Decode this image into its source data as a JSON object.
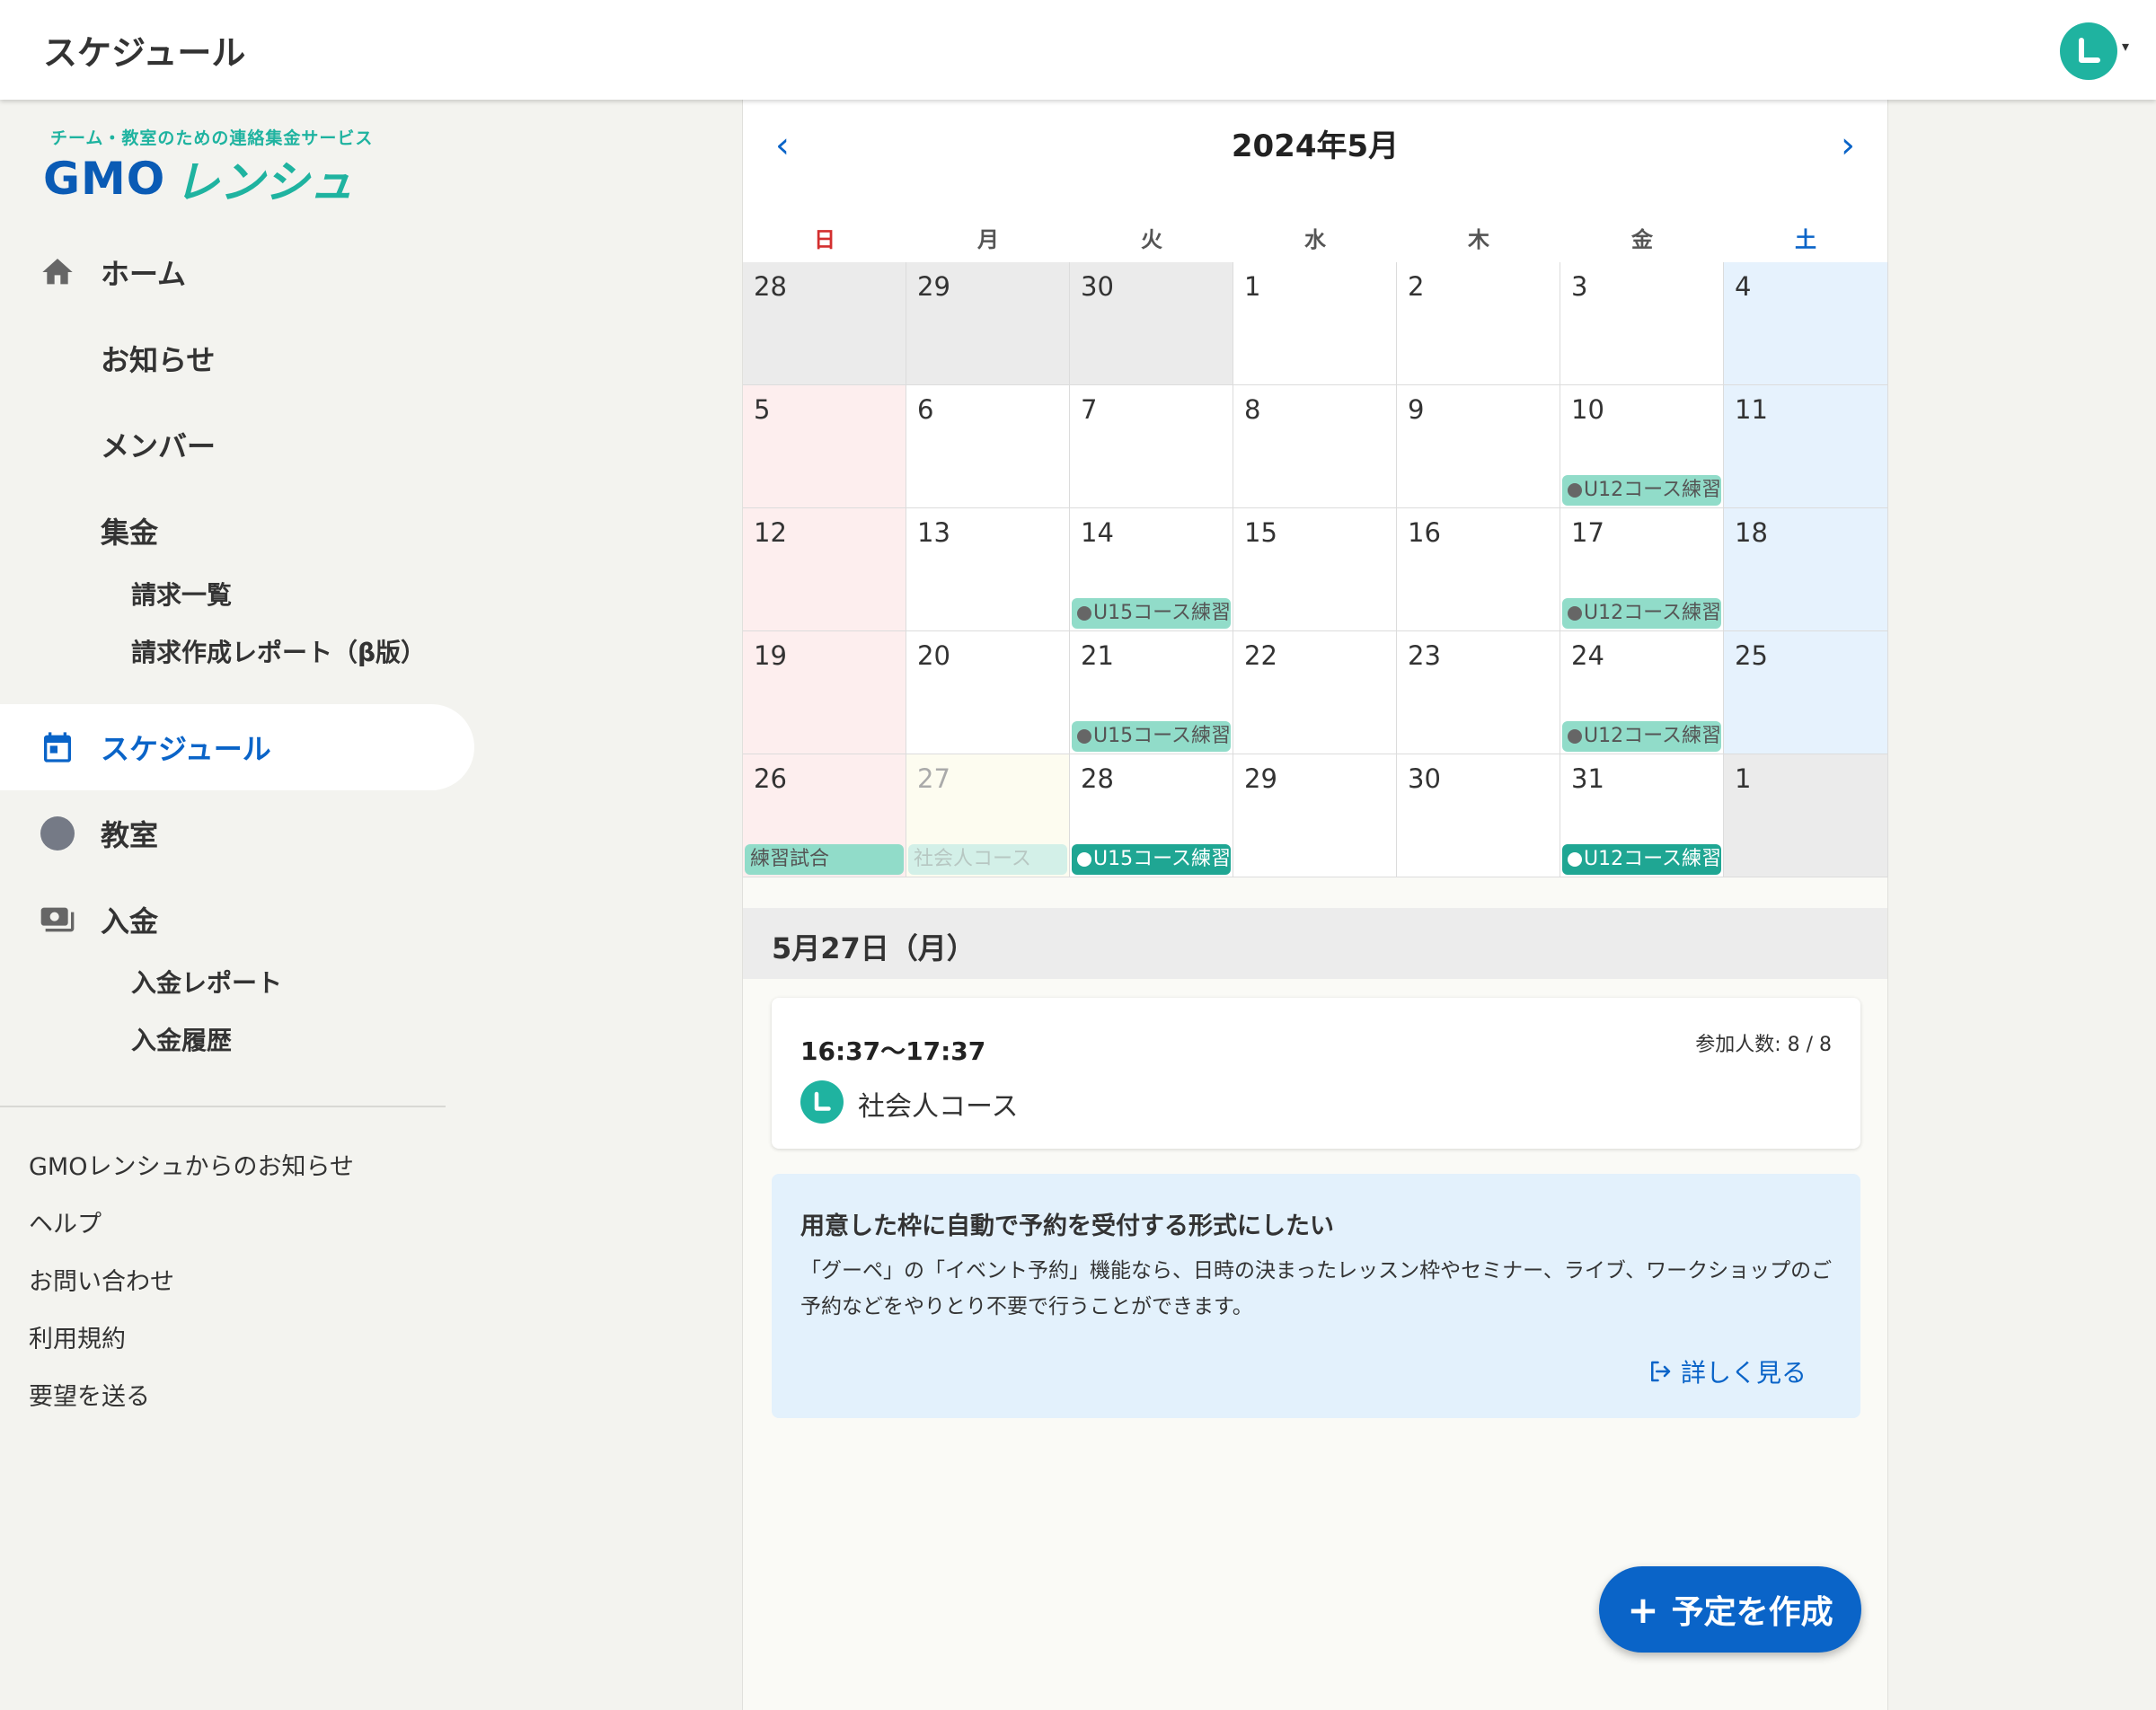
{
  "header": {
    "title": "スケジュール"
  },
  "sidebar": {
    "tagline": "チーム・教室のための連絡集金サービス",
    "logo_gmo": "GMO",
    "logo_ren": "レンシュ",
    "items": [
      {
        "label": "ホーム"
      },
      {
        "label": "お知らせ"
      },
      {
        "label": "メンバー"
      },
      {
        "label": "集金"
      },
      {
        "label": "請求一覧"
      },
      {
        "label": "請求作成レポート（β版）"
      },
      {
        "label": "スケジュール"
      },
      {
        "label": "教室"
      },
      {
        "label": "入金"
      },
      {
        "label": "入金レポート"
      },
      {
        "label": "入金履歴"
      }
    ],
    "footer": [
      {
        "label": "GMOレンシュからのお知らせ"
      },
      {
        "label": "ヘルプ"
      },
      {
        "label": "お問い合わせ"
      },
      {
        "label": "利用規約"
      },
      {
        "label": "要望を送る"
      }
    ]
  },
  "calendar": {
    "title": "2024年5月",
    "prev": "‹",
    "next": "›",
    "weekdays": [
      "日",
      "月",
      "火",
      "水",
      "木",
      "金",
      "土"
    ],
    "weekday_colors": [
      "#d32f2f",
      "#555555",
      "#555555",
      "#555555",
      "#555555",
      "#555555",
      "#0a64c8"
    ],
    "colors": {
      "gray_cell": "#ebebeb",
      "sunday_cell": "#fdeeee",
      "saturday_cell": "#e6f2fd",
      "selected_cell": "#fdfcf0",
      "event_light": "#91dcc9",
      "event_dark": "#1fa693"
    },
    "weeks": [
      [
        {
          "day": "28",
          "style": "gray"
        },
        {
          "day": "29",
          "style": "gray"
        },
        {
          "day": "30",
          "style": "gray"
        },
        {
          "day": "1",
          "style": "normal"
        },
        {
          "day": "2",
          "style": "normal"
        },
        {
          "day": "3",
          "style": "normal"
        },
        {
          "day": "4",
          "style": "sat"
        }
      ],
      [
        {
          "day": "5",
          "style": "sun"
        },
        {
          "day": "6",
          "style": "normal"
        },
        {
          "day": "7",
          "style": "normal"
        },
        {
          "day": "8",
          "style": "normal"
        },
        {
          "day": "9",
          "style": "normal"
        },
        {
          "day": "10",
          "style": "normal",
          "event": {
            "label": "U12コース練習",
            "dot": true,
            "variant": "light"
          }
        },
        {
          "day": "11",
          "style": "sat"
        }
      ],
      [
        {
          "day": "12",
          "style": "sun"
        },
        {
          "day": "13",
          "style": "normal"
        },
        {
          "day": "14",
          "style": "normal",
          "event": {
            "label": "U15コース練習",
            "dot": true,
            "variant": "light"
          }
        },
        {
          "day": "15",
          "style": "normal"
        },
        {
          "day": "16",
          "style": "normal"
        },
        {
          "day": "17",
          "style": "normal",
          "event": {
            "label": "U12コース練習",
            "dot": true,
            "variant": "light"
          }
        },
        {
          "day": "18",
          "style": "sat"
        }
      ],
      [
        {
          "day": "19",
          "style": "sun"
        },
        {
          "day": "20",
          "style": "normal"
        },
        {
          "day": "21",
          "style": "normal",
          "event": {
            "label": "U15コース練習",
            "dot": true,
            "variant": "light"
          }
        },
        {
          "day": "22",
          "style": "normal"
        },
        {
          "day": "23",
          "style": "normal"
        },
        {
          "day": "24",
          "style": "normal",
          "event": {
            "label": "U12コース練習",
            "dot": true,
            "variant": "light"
          }
        },
        {
          "day": "25",
          "style": "sat"
        }
      ],
      [
        {
          "day": "26",
          "style": "sun",
          "event": {
            "label": "練習試合",
            "dot": false,
            "variant": "light"
          }
        },
        {
          "day": "27",
          "style": "selected",
          "event": {
            "label": "社会人コース",
            "dot": false,
            "variant": "faded"
          }
        },
        {
          "day": "28",
          "style": "normal",
          "event": {
            "label": "U15コース練習",
            "dot": true,
            "variant": "dark"
          }
        },
        {
          "day": "29",
          "style": "normal"
        },
        {
          "day": "30",
          "style": "normal"
        },
        {
          "day": "31",
          "style": "normal",
          "event": {
            "label": "U12コース練習",
            "dot": true,
            "variant": "dark"
          }
        },
        {
          "day": "1",
          "style": "gray"
        }
      ]
    ]
  },
  "detail": {
    "date_title": "5月27日（月）",
    "event": {
      "time": "16:37〜17:37",
      "count": "参加人数: 8 / 8",
      "name": "社会人コース"
    }
  },
  "promo": {
    "title": "用意した枠に自動で予約を受付する形式にしたい",
    "body": "「グーペ」の「イベント予約」機能なら、日時の決まったレッスン枠やセミナー、ライブ、ワークショップのご予約などをやりとり不要で行うことができます。",
    "link": "詳しく見る"
  },
  "fab": {
    "label": "予定を作成",
    "plus": "+"
  }
}
